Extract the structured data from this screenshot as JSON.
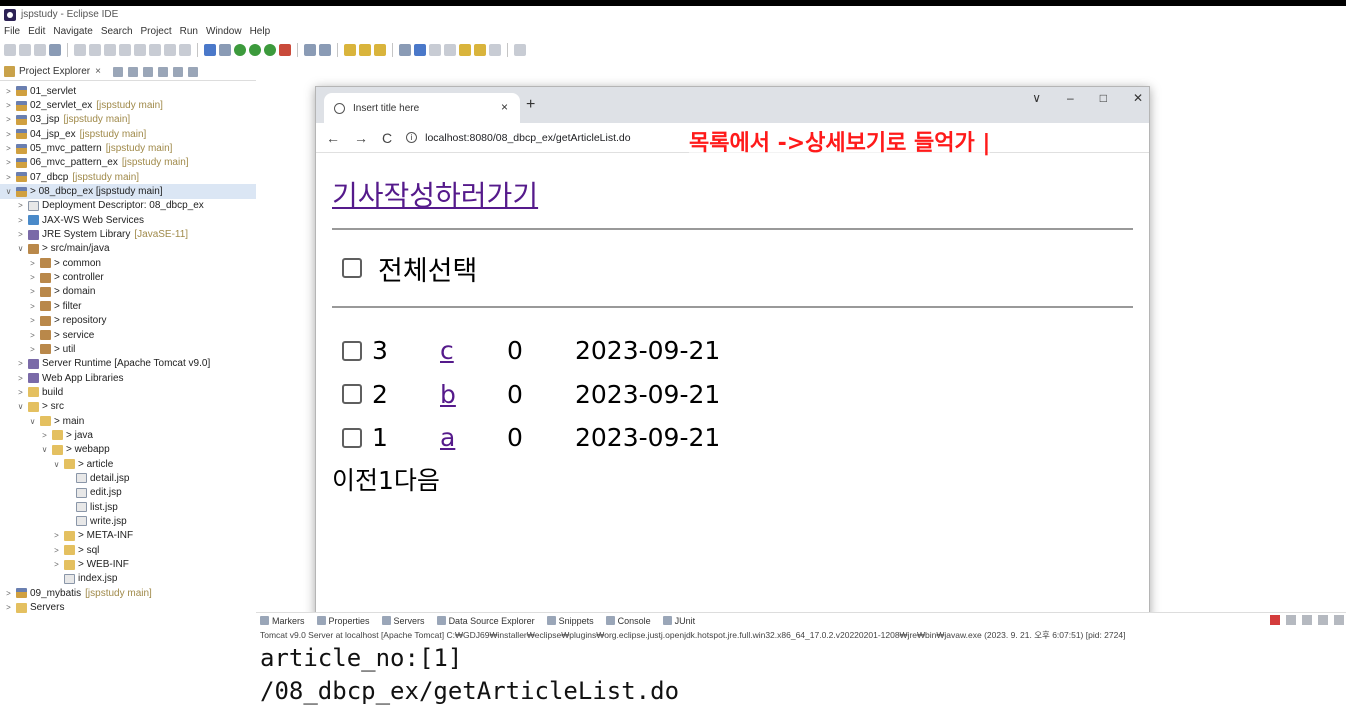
{
  "window": {
    "title": "jspstudy - Eclipse IDE"
  },
  "menu": [
    "File",
    "Edit",
    "Navigate",
    "Search",
    "Project",
    "Run",
    "Window",
    "Help"
  ],
  "explorer": {
    "tab_label": "Project Explorer",
    "close": "×",
    "items": [
      {
        "name": "01_servlet",
        "deco": "",
        "twisty": ">",
        "icon": "proj",
        "indent": 0
      },
      {
        "name": "02_servlet_ex",
        "deco": "[jspstudy main]",
        "twisty": ">",
        "icon": "proj",
        "indent": 0
      },
      {
        "name": "03_jsp",
        "deco": "[jspstudy main]",
        "twisty": ">",
        "icon": "proj",
        "indent": 0
      },
      {
        "name": "04_jsp_ex",
        "deco": "[jspstudy main]",
        "twisty": ">",
        "icon": "proj",
        "indent": 0
      },
      {
        "name": "05_mvc_pattern",
        "deco": "[jspstudy main]",
        "twisty": ">",
        "icon": "proj",
        "indent": 0
      },
      {
        "name": "06_mvc_pattern_ex",
        "deco": "[jspstudy main]",
        "twisty": ">",
        "icon": "proj",
        "indent": 0
      },
      {
        "name": "07_dbcp",
        "deco": "[jspstudy main]",
        "twisty": ">",
        "icon": "proj",
        "indent": 0
      },
      {
        "name": "> 08_dbcp_ex [jspstudy main]",
        "deco": "",
        "twisty": "∨",
        "icon": "proj",
        "indent": 0,
        "selected": true
      },
      {
        "name": "Deployment Descriptor: 08_dbcp_ex",
        "deco": "",
        "twisty": ">",
        "icon": "file",
        "indent": 1
      },
      {
        "name": "JAX-WS Web Services",
        "deco": "",
        "twisty": ">",
        "icon": "web",
        "indent": 1
      },
      {
        "name": "JRE System Library",
        "deco": "[JavaSE-11]",
        "twisty": ">",
        "icon": "lib",
        "indent": 1
      },
      {
        "name": "> src/main/java",
        "deco": "",
        "twisty": "∨",
        "icon": "pkg",
        "indent": 1
      },
      {
        "name": "> common",
        "deco": "",
        "twisty": ">",
        "icon": "pkg",
        "indent": 2
      },
      {
        "name": "> controller",
        "deco": "",
        "twisty": ">",
        "icon": "pkg",
        "indent": 2
      },
      {
        "name": "> domain",
        "deco": "",
        "twisty": ">",
        "icon": "pkg",
        "indent": 2
      },
      {
        "name": "> filter",
        "deco": "",
        "twisty": ">",
        "icon": "pkg",
        "indent": 2
      },
      {
        "name": "> repository",
        "deco": "",
        "twisty": ">",
        "icon": "pkg",
        "indent": 2
      },
      {
        "name": "> service",
        "deco": "",
        "twisty": ">",
        "icon": "pkg",
        "indent": 2
      },
      {
        "name": "> util",
        "deco": "",
        "twisty": ">",
        "icon": "pkg",
        "indent": 2
      },
      {
        "name": "Server Runtime [Apache Tomcat v9.0]",
        "deco": "",
        "twisty": ">",
        "icon": "lib",
        "indent": 1
      },
      {
        "name": "Web App Libraries",
        "deco": "",
        "twisty": ">",
        "icon": "lib",
        "indent": 1
      },
      {
        "name": "build",
        "deco": "",
        "twisty": ">",
        "icon": "folder",
        "indent": 1
      },
      {
        "name": "> src",
        "deco": "",
        "twisty": "∨",
        "icon": "folder",
        "indent": 1
      },
      {
        "name": "> main",
        "deco": "",
        "twisty": "∨",
        "icon": "folder",
        "indent": 2
      },
      {
        "name": "> java",
        "deco": "",
        "twisty": ">",
        "icon": "folder",
        "indent": 3
      },
      {
        "name": "> webapp",
        "deco": "",
        "twisty": "∨",
        "icon": "folder",
        "indent": 3
      },
      {
        "name": "> article",
        "deco": "",
        "twisty": "∨",
        "icon": "folder",
        "indent": 4
      },
      {
        "name": "detail.jsp",
        "deco": "",
        "twisty": "",
        "icon": "file",
        "indent": 5
      },
      {
        "name": "edit.jsp",
        "deco": "",
        "twisty": "",
        "icon": "file",
        "indent": 5
      },
      {
        "name": "list.jsp",
        "deco": "",
        "twisty": "",
        "icon": "file",
        "indent": 5
      },
      {
        "name": "write.jsp",
        "deco": "",
        "twisty": "",
        "icon": "file",
        "indent": 5
      },
      {
        "name": "> META-INF",
        "deco": "",
        "twisty": ">",
        "icon": "folder",
        "indent": 4
      },
      {
        "name": "> sql",
        "deco": "",
        "twisty": ">",
        "icon": "folder",
        "indent": 4
      },
      {
        "name": "> WEB-INF",
        "deco": "",
        "twisty": ">",
        "icon": "folder",
        "indent": 4
      },
      {
        "name": "index.jsp",
        "deco": "",
        "twisty": "",
        "icon": "file",
        "indent": 4
      },
      {
        "name": "09_mybatis",
        "deco": "[jspstudy main]",
        "twisty": ">",
        "icon": "proj",
        "indent": 0
      },
      {
        "name": "Servers",
        "deco": "",
        "twisty": ">",
        "icon": "folder",
        "indent": 0
      }
    ]
  },
  "browser": {
    "tab_title": "Insert title here",
    "tab_close": "×",
    "new_tab": "+",
    "controls": [
      "∨",
      "–",
      "□",
      "✕"
    ],
    "nav": [
      "←",
      "→",
      "C"
    ],
    "url": "localhost:8080/08_dbcp_ex/getArticleList.do",
    "overlay_note": "목록에서 ->상세보기로 들억가 |"
  },
  "page": {
    "write_link": "기사작성하러가기",
    "select_all": "전체선택",
    "articles": [
      {
        "no": "3",
        "title": "c",
        "count": "0",
        "date": "2023-09-21"
      },
      {
        "no": "2",
        "title": "b",
        "count": "0",
        "date": "2023-09-21"
      },
      {
        "no": "1",
        "title": "a",
        "count": "0",
        "date": "2023-09-21"
      }
    ],
    "pager": "이전1다음"
  },
  "console": {
    "tabs": [
      "Markers",
      "Properties",
      "Servers",
      "Data Source Explorer",
      "Snippets",
      "Console",
      "JUnit"
    ],
    "description": "Tomcat v9.0 Server at localhost [Apache Tomcat] C:₩GDJ69₩installer₩eclipse₩plugins₩org.eclipse.justj.openjdk.hotspot.jre.full.win32.x86_64_17.0.2.v20220201-1208₩jre₩bin₩javaw.exe  (2023. 9. 21. 오후 6:07:51) [pid: 2724]",
    "lines": [
      "article_no:[1]",
      "/08_dbcp_ex/getArticleList.do"
    ]
  }
}
